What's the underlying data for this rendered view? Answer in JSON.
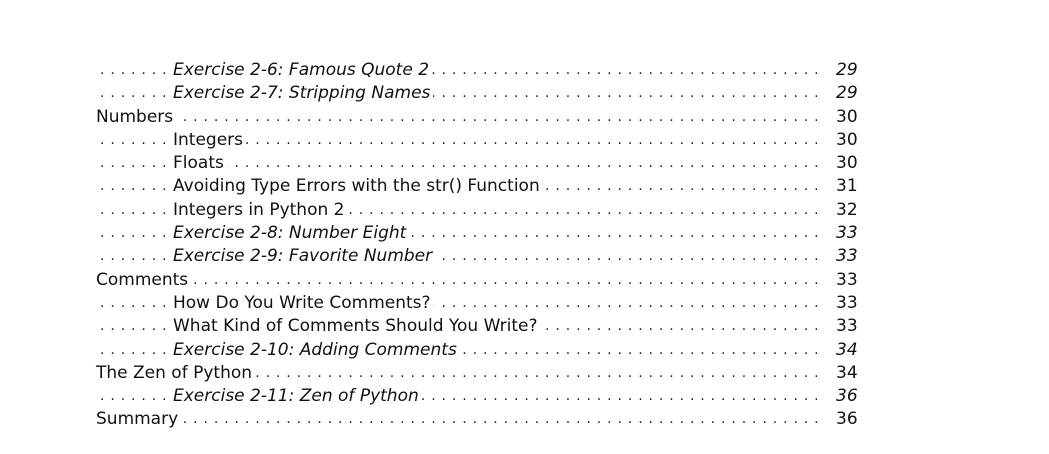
{
  "toc": {
    "entries": [
      {
        "title": "Exercise 2-6: Famous Quote 2",
        "page": "29",
        "level": 1,
        "italic": true
      },
      {
        "title": "Exercise 2-7: Stripping Names",
        "page": "29",
        "level": 1,
        "italic": true
      },
      {
        "title": "Numbers",
        "page": "30",
        "level": 0,
        "italic": false
      },
      {
        "title": "Integers",
        "page": "30",
        "level": 1,
        "italic": false
      },
      {
        "title": "Floats",
        "page": "30",
        "level": 1,
        "italic": false
      },
      {
        "title": "Avoiding Type Errors with the str() Function",
        "page": "31",
        "level": 1,
        "italic": false
      },
      {
        "title": "Integers in Python 2",
        "page": "32",
        "level": 1,
        "italic": false
      },
      {
        "title": "Exercise 2-8: Number Eight",
        "page": "33",
        "level": 1,
        "italic": true
      },
      {
        "title": "Exercise 2-9: Favorite Number",
        "page": "33",
        "level": 1,
        "italic": true
      },
      {
        "title": "Comments",
        "page": "33",
        "level": 0,
        "italic": false
      },
      {
        "title": "How Do You Write Comments?",
        "page": "33",
        "level": 1,
        "italic": false
      },
      {
        "title": "What Kind of Comments Should You Write?",
        "page": "33",
        "level": 1,
        "italic": false
      },
      {
        "title": "Exercise 2-10: Adding Comments",
        "page": "34",
        "level": 1,
        "italic": true
      },
      {
        "title": "The Zen of Python",
        "page": "34",
        "level": 0,
        "italic": false
      },
      {
        "title": "Exercise 2-11: Zen of Python",
        "page": "36",
        "level": 1,
        "italic": true
      },
      {
        "title": "Summary",
        "page": "36",
        "level": 0,
        "italic": false
      }
    ]
  }
}
